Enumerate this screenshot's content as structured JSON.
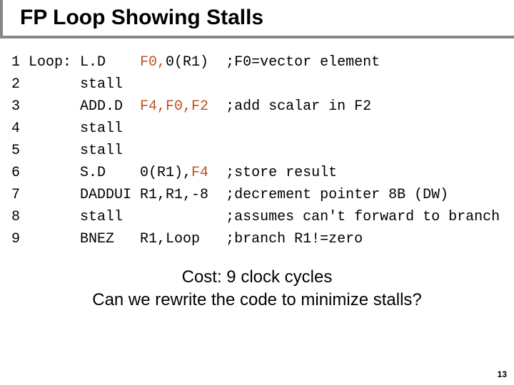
{
  "title": "FP Loop Showing Stalls",
  "code": {
    "lines": [
      {
        "n": "1",
        "label": "Loop:",
        "op": "L.D",
        "args_plain": "",
        "args_reg": "F0,",
        "args_tail": "0(R1)",
        "comment": ";F0=vector element"
      },
      {
        "n": "2",
        "label": "",
        "op": "stall",
        "args_plain": "",
        "args_reg": "",
        "args_tail": "",
        "comment": ""
      },
      {
        "n": "3",
        "label": "",
        "op": "ADD.D",
        "args_plain": "",
        "args_reg": "F4,F0,F2",
        "args_tail": "",
        "comment": ";add scalar in F2"
      },
      {
        "n": "4",
        "label": "",
        "op": "stall",
        "args_plain": "",
        "args_reg": "",
        "args_tail": "",
        "comment": ""
      },
      {
        "n": "5",
        "label": "",
        "op": "stall",
        "args_plain": "",
        "args_reg": "",
        "args_tail": "",
        "comment": ""
      },
      {
        "n": "6",
        "label": "",
        "op": "S.D",
        "args_plain": "0(R1),",
        "args_reg": "F4",
        "args_tail": "",
        "comment": ";store result"
      },
      {
        "n": "7",
        "label": "",
        "op": "DADDUI",
        "args_plain": "R1,R1,-8",
        "args_reg": "",
        "args_tail": "",
        "comment": ";decrement pointer 8B (DW)"
      },
      {
        "n": "8",
        "label": "",
        "op": "stall",
        "args_plain": "",
        "args_reg": "",
        "args_tail": "",
        "comment": ";assumes can't forward to branch"
      },
      {
        "n": "9",
        "label": "",
        "op": "BNEZ",
        "args_plain": "R1,Loop",
        "args_reg": "",
        "args_tail": "",
        "comment": ";branch R1!=zero"
      }
    ]
  },
  "summary": {
    "line1": "Cost: 9 clock cycles",
    "line2": "Can we rewrite the code to minimize stalls?"
  },
  "page_number": "13"
}
